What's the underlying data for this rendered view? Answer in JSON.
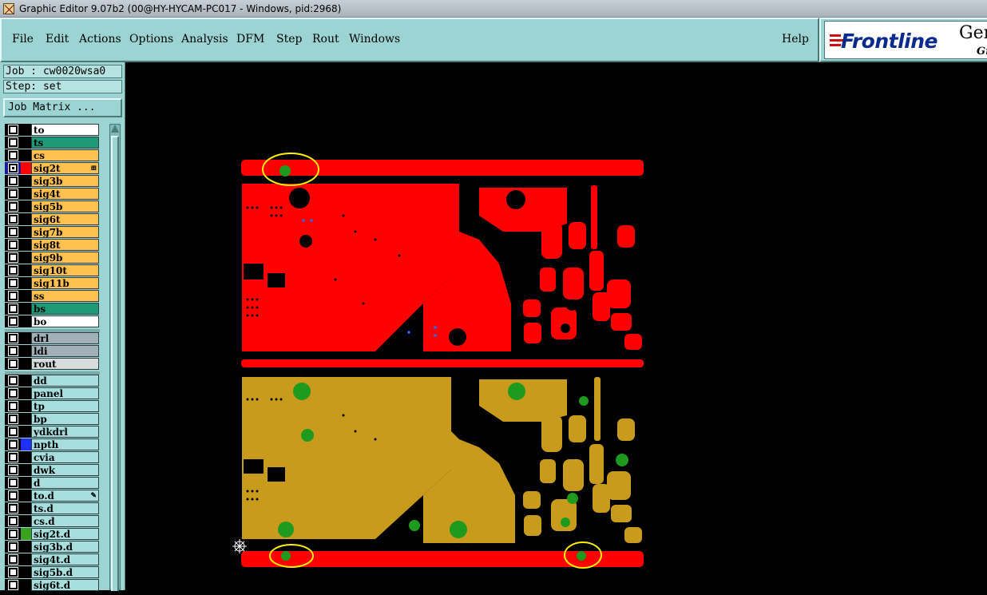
{
  "window": {
    "title": "Graphic Editor 9.07b2 (00@HY-HYCAM-PC017 - Windows, pid:2968)"
  },
  "menu": {
    "file": "File",
    "edit": "Edit",
    "actions": "Actions",
    "options": "Options",
    "analysis": "Analysis",
    "dfm": "DFM",
    "step": "Step",
    "rout": "Rout",
    "windows": "Windows",
    "help": "Help"
  },
  "logo": {
    "brand": "Frontline",
    "gen": "Gen",
    "gr": "Gr"
  },
  "job": {
    "label": "Job : cw0020wsa0",
    "step": "Step: set",
    "matrix_button": "Job Matrix ..."
  },
  "colors": {
    "board": "#ff0000",
    "layer_white": "#ffffff",
    "layer_green": "#1f9a78",
    "layer_orange": "#ffc050",
    "layer_gray": "#a4b0b8",
    "layer_light": "#d8dcdc",
    "layer_cyan": "#a8dede",
    "pad_green": "#1e9a1e",
    "copper_gold": "#c89b1c",
    "highlight_yellow": "#ffee00"
  },
  "layers": [
    {
      "name": "to",
      "color": "#ffffff"
    },
    {
      "name": "ts",
      "color": "#1f9a78"
    },
    {
      "name": "cs",
      "color": "#ffc050"
    },
    {
      "name": "sig2t",
      "color": "#ffc050",
      "active": true,
      "swatch": "#ff0000",
      "mark": "⊞"
    },
    {
      "name": "sig3b",
      "color": "#ffc050"
    },
    {
      "name": "sig4t",
      "color": "#ffc050"
    },
    {
      "name": "sig5b",
      "color": "#ffc050"
    },
    {
      "name": "sig6t",
      "color": "#ffc050"
    },
    {
      "name": "sig7b",
      "color": "#ffc050"
    },
    {
      "name": "sig8t",
      "color": "#ffc050"
    },
    {
      "name": "sig9b",
      "color": "#ffc050"
    },
    {
      "name": "sig10t",
      "color": "#ffc050"
    },
    {
      "name": "sig11b",
      "color": "#ffc050"
    },
    {
      "name": "ss",
      "color": "#ffc050"
    },
    {
      "name": "bs",
      "color": "#1f9a78"
    },
    {
      "name": "bo",
      "color": "#ffffff"
    },
    {
      "name": "drl",
      "color": "#a4b0b8",
      "group": 2
    },
    {
      "name": "ldi",
      "color": "#a4b0b8",
      "group": 2
    },
    {
      "name": "rout",
      "color": "#d8dcdc",
      "group": 2
    },
    {
      "name": "dd",
      "color": "#a8dede",
      "group": 3
    },
    {
      "name": "panel",
      "color": "#a8dede",
      "group": 3
    },
    {
      "name": "tp",
      "color": "#a8dede",
      "group": 3
    },
    {
      "name": "bp",
      "color": "#a8dede",
      "group": 3
    },
    {
      "name": "ydkdrl",
      "color": "#a8dede",
      "group": 3
    },
    {
      "name": "npth",
      "color": "#a8dede",
      "group": 3,
      "swatch": "#1f2fff"
    },
    {
      "name": "cvia",
      "color": "#a8dede",
      "group": 3
    },
    {
      "name": "dwk",
      "color": "#a8dede",
      "group": 3
    },
    {
      "name": "d",
      "color": "#a8dede",
      "group": 3
    },
    {
      "name": "to.d",
      "color": "#a8dede",
      "group": 3,
      "mark": "✎"
    },
    {
      "name": "ts.d",
      "color": "#a8dede",
      "group": 3
    },
    {
      "name": "cs.d",
      "color": "#a8dede",
      "group": 3
    },
    {
      "name": "sig2t.d",
      "color": "#a8dede",
      "group": 3,
      "swatch": "#3aa020"
    },
    {
      "name": "sig3b.d",
      "color": "#a8dede",
      "group": 3
    },
    {
      "name": "sig4t.d",
      "color": "#a8dede",
      "group": 3
    },
    {
      "name": "sig5b.d",
      "color": "#a8dede",
      "group": 3
    },
    {
      "name": "sig6t.d",
      "color": "#a8dede",
      "group": 3
    }
  ],
  "icons": {
    "app": "graphic-editor-icon",
    "origin": "crosshair-origin-icon",
    "scroll_up": "arrow-up-icon"
  }
}
